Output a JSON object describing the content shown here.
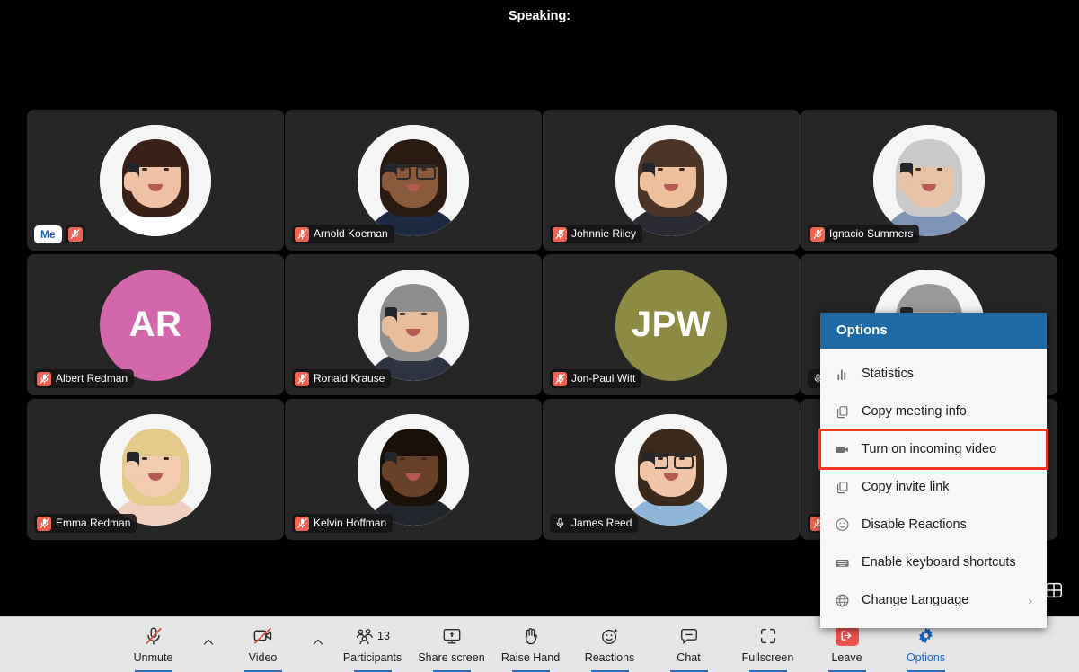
{
  "header": {
    "speaking_label": "Speaking:"
  },
  "grid": {
    "layout_icon": "grid-layout-icon",
    "tiles": [
      {
        "name": "",
        "me_label": "Me",
        "is_me": true,
        "muted": true,
        "avatar_type": "photo",
        "skin": "#f0c0a4",
        "hair": "#3a2118",
        "cloth": "#ffffff",
        "glasses": false
      },
      {
        "name": "Arnold Koeman",
        "muted": true,
        "avatar_type": "photo",
        "skin": "#8a5a3c",
        "hair": "#2a1a12",
        "cloth": "#1d2a42",
        "glasses": true
      },
      {
        "name": "Johnnie Riley",
        "muted": true,
        "avatar_type": "photo",
        "skin": "#edbf9c",
        "hair": "#4a3526",
        "cloth": "#2b2b33",
        "glasses": false
      },
      {
        "name": "Ignacio Summers",
        "muted": true,
        "avatar_type": "photo",
        "skin": "#e8c2a6",
        "hair": "#c9c9c9",
        "cloth": "#7e93b5",
        "glasses": false
      },
      {
        "name": "Albert Redman",
        "muted": true,
        "avatar_type": "initials",
        "initials": "AR",
        "avatar_color": "#d367ab"
      },
      {
        "name": "Ronald Krause",
        "muted": true,
        "avatar_type": "photo",
        "skin": "#e8bd9c",
        "hair": "#8e8e8e",
        "cloth": "#2e3442",
        "glasses": false
      },
      {
        "name": "Jon-Paul Witt",
        "muted": true,
        "avatar_type": "initials",
        "initials": "JPW",
        "avatar_color": "#8d8a43"
      },
      {
        "name": "",
        "muted": false,
        "avatar_type": "photo",
        "obscured": true,
        "skin": "#e6bb9b",
        "hair": "#9a9a9a",
        "cloth": "#3a3f4a",
        "glasses": false
      },
      {
        "name": "Emma Redman",
        "muted": true,
        "avatar_type": "photo",
        "skin": "#f3cbb0",
        "hair": "#e3c98a",
        "cloth": "#f0cfc0",
        "glasses": false
      },
      {
        "name": "Kelvin Hoffman",
        "muted": true,
        "avatar_type": "photo",
        "skin": "#69412a",
        "hair": "#1a1008",
        "cloth": "#22252c",
        "glasses": false
      },
      {
        "name": "James Reed",
        "muted": false,
        "avatar_type": "photo",
        "skin": "#f0c4a6",
        "hair": "#3b2a1c",
        "cloth": "#8fb6d8",
        "glasses": true
      },
      {
        "name": "",
        "muted": true,
        "avatar_type": "photo",
        "obscured": true,
        "skin": "#e8c2a6",
        "hair": "#55402c",
        "cloth": "#2b3040",
        "glasses": false
      }
    ]
  },
  "options_menu": {
    "title": "Options",
    "items": [
      {
        "label": "Statistics",
        "icon": "bar-chart-icon",
        "highlighted": false,
        "submenu": false
      },
      {
        "label": "Copy meeting info",
        "icon": "copy-icon",
        "highlighted": false,
        "submenu": false
      },
      {
        "label": "Turn on incoming video",
        "icon": "video-camera-icon",
        "highlighted": true,
        "submenu": false
      },
      {
        "label": "Copy invite link",
        "icon": "copy-icon",
        "highlighted": false,
        "submenu": false
      },
      {
        "label": "Disable Reactions",
        "icon": "smiley-icon",
        "highlighted": false,
        "submenu": false
      },
      {
        "label": "Enable keyboard shortcuts",
        "icon": "keyboard-icon",
        "highlighted": false,
        "submenu": false
      },
      {
        "label": "Change Language",
        "icon": "globe-icon",
        "highlighted": false,
        "submenu": true,
        "chevron": "›"
      }
    ],
    "highlight_color": "#f4331f",
    "header_color": "#1e6ba8"
  },
  "toolbar": {
    "buttons": [
      {
        "label": "Unmute",
        "icon": "mic-muted-icon",
        "accent": false,
        "caret_after": true
      },
      {
        "label": "Video",
        "icon": "video-off-icon",
        "accent": false,
        "caret_after": true
      },
      {
        "label": "Participants",
        "icon": "participants-icon",
        "accent": false,
        "count": "13"
      },
      {
        "label": "Share screen",
        "icon": "share-screen-icon",
        "accent": false
      },
      {
        "label": "Raise Hand",
        "icon": "raise-hand-icon",
        "accent": false
      },
      {
        "label": "Reactions",
        "icon": "reactions-icon",
        "accent": false
      },
      {
        "label": "Chat",
        "icon": "chat-icon",
        "accent": false
      },
      {
        "label": "Fullscreen",
        "icon": "fullscreen-icon",
        "accent": false
      },
      {
        "label": "Leave",
        "icon": "leave-icon",
        "accent": false
      },
      {
        "label": "Options",
        "icon": "gear-icon",
        "accent": true
      }
    ],
    "accent_color": "#1a66c2",
    "leave_color": "#ef5350"
  }
}
